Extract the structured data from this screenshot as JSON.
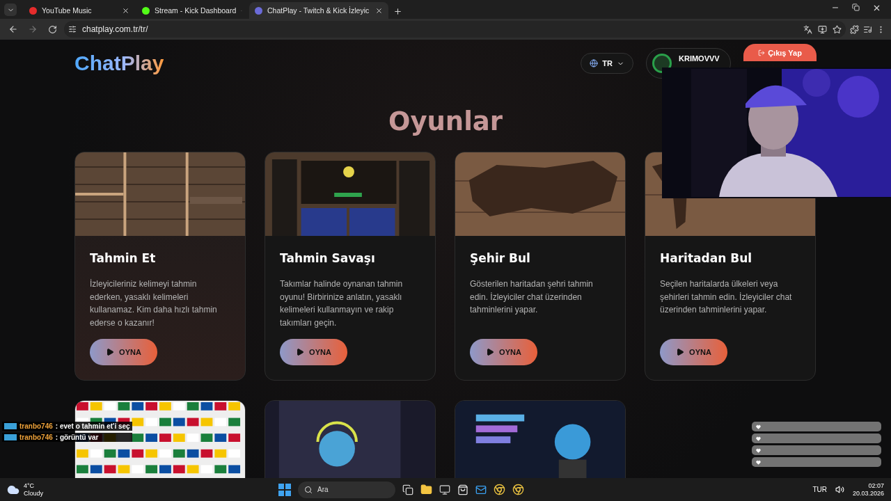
{
  "browser": {
    "tabs": [
      {
        "title": "YouTube Music",
        "selected": false
      },
      {
        "title": "Stream - Kick Dashboard",
        "selected": false
      },
      {
        "title": "ChatPlay - Twitch & Kick İzleyic",
        "selected": true
      }
    ],
    "address": "chatplay.com.tr/tr/"
  },
  "header": {
    "logo": "ChatPlay",
    "language": "TR",
    "user": {
      "name": "KRIMOVVV"
    },
    "logout": "Çıkış Yap"
  },
  "heading": "Oyunlar",
  "games": [
    {
      "title": "Tahmin Et",
      "description": "İzleyicileriniz kelimeyi tahmin ederken, yasaklı kelimeleri kullanamaz. Kim daha hızlı tahmin ederse o kazanır!",
      "button": "OYNA",
      "selected": true
    },
    {
      "title": "Tahmin Savaşı",
      "description": "Takımlar halinde oynanan tahmin oyunu! Birbirinize anlatın, yasaklı kelimeleri kullanmayın ve rakip takımları geçin.",
      "button": "OYNA",
      "selected": false
    },
    {
      "title": "Şehir Bul",
      "description": "Gösterilen haritadan şehri tahmin edin. İzleyiciler chat üzerinden tahminlerini yapar.",
      "button": "OYNA",
      "selected": false
    },
    {
      "title": "Haritadan Bul",
      "description": "Seçilen haritalarda ülkeleri veya şehirleri tahmin edin. İzleyiciler chat üzerinden tahminlerini yapar.",
      "button": "OYNA",
      "selected": false
    }
  ],
  "stream_chat": [
    {
      "user": "tranbo746",
      "message": ": evet o tahmin et'i seç"
    },
    {
      "user": "tranbo746",
      "message": ": görüntü var"
    }
  ],
  "taskbar": {
    "weather": {
      "temperature": "4°C",
      "condition": "Cloudy"
    },
    "search": {
      "placeholder": "Ara"
    },
    "language": "TUR",
    "time": "02:07",
    "date": "20.03.2026"
  }
}
